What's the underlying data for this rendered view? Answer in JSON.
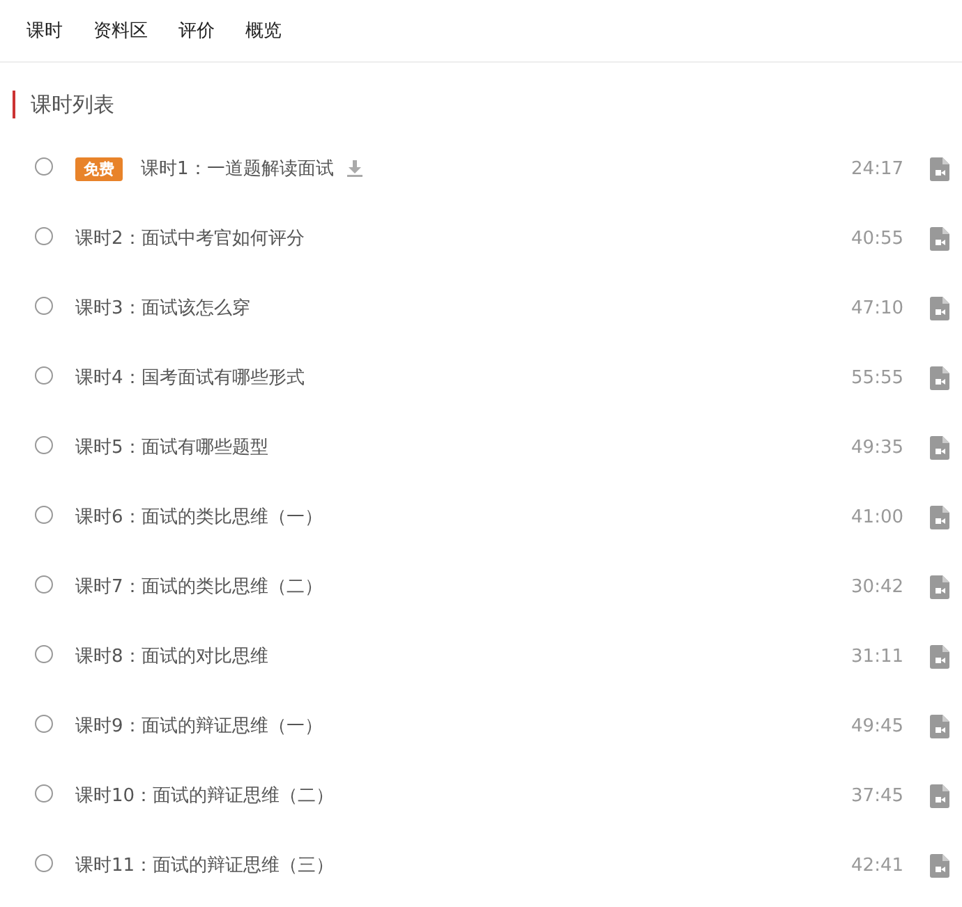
{
  "tabs": [
    {
      "label": "课时"
    },
    {
      "label": "资料区"
    },
    {
      "label": "评价"
    },
    {
      "label": "概览"
    }
  ],
  "section_title": "课时列表",
  "lessons": [
    {
      "selected": false,
      "badge": "免费",
      "title": "课时1：一道题解读面试",
      "downloadable": true,
      "duration": "24:17"
    },
    {
      "selected": false,
      "title": "课时2：面试中考官如何评分",
      "downloadable": false,
      "duration": "40:55"
    },
    {
      "selected": false,
      "title": "课时3：面试该怎么穿",
      "downloadable": false,
      "duration": "47:10"
    },
    {
      "selected": false,
      "title": "课时4：国考面试有哪些形式",
      "downloadable": false,
      "duration": "55:55"
    },
    {
      "selected": false,
      "title": "课时5：面试有哪些题型",
      "downloadable": false,
      "duration": "49:35"
    },
    {
      "selected": false,
      "title": "课时6：面试的类比思维（一）",
      "downloadable": false,
      "duration": "41:00"
    },
    {
      "selected": false,
      "title": "课时7：面试的类比思维（二）",
      "downloadable": false,
      "duration": "30:42"
    },
    {
      "selected": false,
      "title": "课时8：面试的对比思维",
      "downloadable": false,
      "duration": "31:11"
    },
    {
      "selected": false,
      "title": "课时9：面试的辩证思维（一）",
      "downloadable": false,
      "duration": "49:45"
    },
    {
      "selected": false,
      "title": "课时10：面试的辩证思维（二）",
      "downloadable": false,
      "duration": "37:45"
    },
    {
      "selected": false,
      "title": "课时11：面试的辩证思维（三）",
      "downloadable": false,
      "duration": "42:41"
    }
  ]
}
